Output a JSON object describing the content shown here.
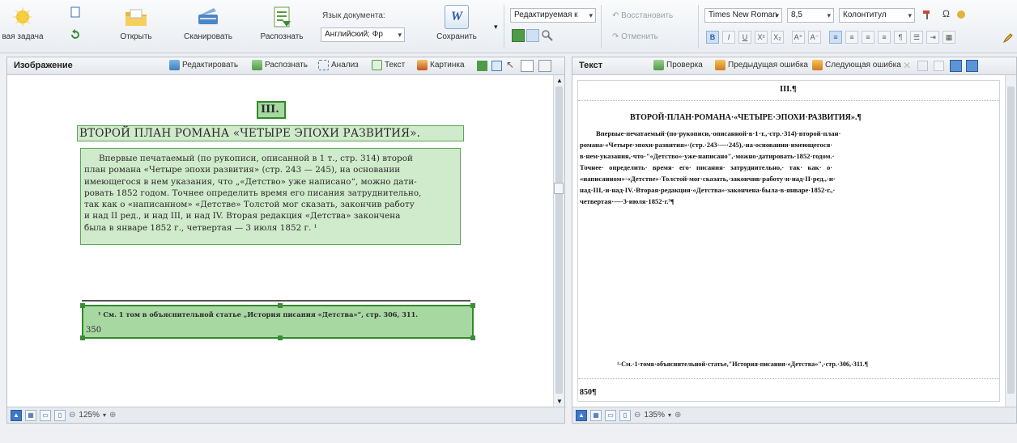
{
  "ribbon": {
    "new_task": "вая задача",
    "open": "Открыть",
    "scan": "Сканировать",
    "recognize": "Распознать",
    "doc_language_label": "Язык документа:",
    "doc_language_value": "Английский; Фр",
    "save": "Сохранить",
    "save_format": "W",
    "format_combo": "Редактируемая к",
    "restore": "Восстановить",
    "cancel": "Отменить",
    "font_name": "Times New Roman",
    "font_size": "8,5",
    "style_combo": "Колонтитул",
    "fmt": {
      "bold": "B",
      "italic": "I",
      "underline": "U",
      "superscript": "X²",
      "subscript": "X₂",
      "grow": "A⁺",
      "shrink": "A⁻"
    }
  },
  "image_panel": {
    "title": "Изображение",
    "tools": [
      "Редактировать",
      "Распознать",
      "Анализ",
      "Текст",
      "Картинка"
    ],
    "page_number": "III.",
    "heading": "ВТОРОЙ ПЛАН РОМАНА «ЧЕТЫРЕ ЭПОХИ РАЗВИТИЯ».",
    "body_lines": [
      "Впервые печатаемый (по рукописи, описанной в 1 т., стр. 314) второй",
      "план романа «Четыре эпохи развития» (стр. 243 — 245), на основании",
      "имеющегося в нем указания, что „«Детство» уже написано“, можно дати-",
      "ровать 1852 годом. Точнее определить время его писания затруднительно,",
      "так как о «написанном» «Детстве» Толстой мог сказать, закончив работу",
      "и над II ред., и над III, и над IV. Вторая редакция «Детства» закончена",
      "была в январе 1852 г., четвертая — 3 июля 1852 г. ¹"
    ],
    "footnote": "¹ См. 1 том в объяснительной статье „История писания «Детства»“, стр. 306, 311.",
    "page_num_bottom": "350",
    "zoom": "125%"
  },
  "text_panel": {
    "title": "Текст",
    "tools": [
      "Проверка",
      "Предыдущая ошибка",
      "Следующая ошибка"
    ],
    "page_number": "III.¶",
    "heading": "ВТОРОЙ·ПЛАН·РОМАНА·«ЧЕТЫРЕ·ЭПОХИ·РАЗВИТИЯ».¶",
    "body_lines": [
      "Впервые·печатаемый·(по·рукописи,·описанной·в·1·т.,·стр.·314)·второй·план·",
      "романа·«Четыре·эпохи·развития»·(стр.·243·—·245),·на·основании·имеющегося·",
      "в·нем·указания,·что·\"«Детство»·уже·написано\",·можно·датировать·1852·годом.·",
      "Точнее·   определить·   время·   его·   писания·   затруднительно,·   так·   как·   о·",
      "«написанном»·«Детстве»·Толстой·мог·сказать,·закончив·работу·и·над·II·ред.,·и·",
      "над·III,·и·над·IV.·Вторая·редакция·«Детства»·закончена·была·в·январе·1852·г.,·",
      "четвертая·—·3·июля·1852·г.³¶"
    ],
    "footnote": "¹·См.·1·томв·объяснительной·статье,\"История·писания·«Детства»\",·стр.·306,·311.¶",
    "page_num_bottom": "850¶",
    "zoom": "135%"
  }
}
